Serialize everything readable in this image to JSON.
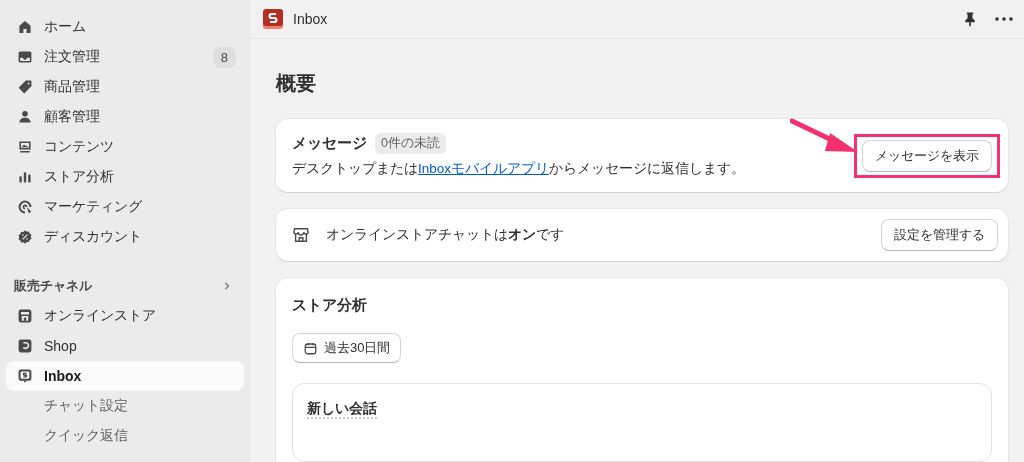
{
  "sidebar": {
    "items": [
      {
        "label": "ホーム",
        "selected": false
      },
      {
        "label": "注文管理",
        "selected": false,
        "badge": "8"
      },
      {
        "label": "商品管理",
        "selected": false
      },
      {
        "label": "顧客管理",
        "selected": false
      },
      {
        "label": "コンテンツ",
        "selected": false
      },
      {
        "label": "ストア分析",
        "selected": false
      },
      {
        "label": "マーケティング",
        "selected": false
      },
      {
        "label": "ディスカウント",
        "selected": false
      }
    ],
    "section": {
      "title": "販売チャネル",
      "items": [
        {
          "label": "オンラインストア",
          "selected": false
        },
        {
          "label": "Shop",
          "selected": false
        },
        {
          "label": "Inbox",
          "selected": true,
          "children": [
            {
              "label": "チャット設定",
              "selected": false
            },
            {
              "label": "クイック返信",
              "selected": false
            }
          ]
        }
      ]
    }
  },
  "topbar": {
    "title": "Inbox"
  },
  "page": {
    "title": "概要",
    "messages_card": {
      "title": "メッセージ",
      "badge": "0件の未読",
      "text_before": "デスクトップまたは",
      "link": "Inboxモバイルアプリ",
      "text_after": "からメッセージに返信します。",
      "button": "メッセージを表示",
      "highlighted": true
    },
    "chat_card": {
      "text": "オンラインストアチャットは**オン**です",
      "button": "設定を管理する"
    },
    "analytics_card": {
      "title": "ストア分析",
      "date_button": "過去30日間",
      "panel": {
        "title": "新しい会話"
      }
    }
  }
}
